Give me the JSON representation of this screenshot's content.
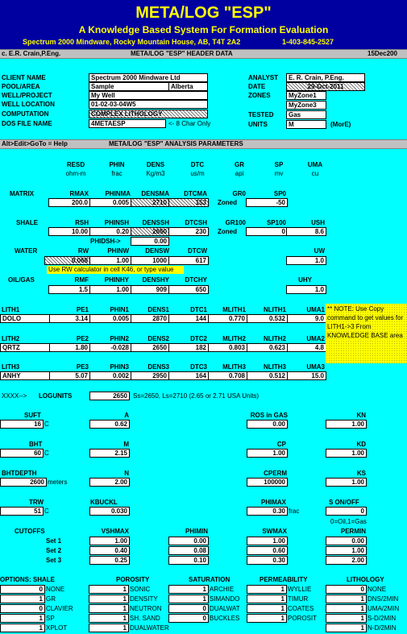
{
  "title": {
    "main": "META/LOG \"ESP\"",
    "sub": "A Knowledge Based System For Formation Evaluation",
    "company": "Spectrum 2000 Mindware, Rocky Mountain House, AB, T4T 2A2",
    "phone": "1-403-845-2527"
  },
  "header_bar": {
    "author": "c. E.R. Crain,P.Eng.",
    "title": "META/LOG \"ESP\" HEADER DATA",
    "date": "15Dec200"
  },
  "header": {
    "client_label": "CLIENT NAME",
    "client": "Spectrum 2000 Mindware Ltd",
    "pool_label": "POOL/AREA",
    "pool": "Sample",
    "area": "Alberta",
    "well_label": "WELL/PROJECT",
    "well": "My Well",
    "loc_label": "WELL LOCATION",
    "loc": "01-02-03-04W5",
    "comp_label": "COMPUTATION",
    "comp": "COMPLEX LITHOLOGY",
    "dos_label": "DOS FILE NAME",
    "dos": "4METAESP",
    "dos_note": "<- 8 Char Only",
    "analyst_label": "ANALYST",
    "analyst": "E. R. Crain, P.Eng.",
    "date_label": "DATE",
    "date": "29-Oct-2011",
    "zones_label": "ZONES",
    "zone1": "MyZone1",
    "zone2": "MyZone3",
    "tested_label": "TESTED",
    "tested": "Gas",
    "units_label": "UNITS",
    "units": "M",
    "units_note": "(MorE)"
  },
  "analysis_bar": {
    "nav": "Alt>Edit>GoTo = Help",
    "title": "META/LOG \"ESP\" ANALYSIS PARAMETERS"
  },
  "col_heads": [
    {
      "name": "RESD",
      "unit": "ohm-m"
    },
    {
      "name": "PHIN",
      "unit": "frac"
    },
    {
      "name": "DENS",
      "unit": "Kg/m3"
    },
    {
      "name": "DTC",
      "unit": "us/m"
    },
    {
      "name": "GR",
      "unit": "api"
    },
    {
      "name": "SP",
      "unit": "mv"
    },
    {
      "name": "UMA",
      "unit": "cu"
    }
  ],
  "matrix": {
    "label": "MATRIX",
    "h": [
      "RMAX",
      "PHINMA",
      "DENSMA",
      "DTCMA",
      "GR0",
      "SP0"
    ],
    "v": [
      "200.0",
      "0.005",
      "2710",
      "153",
      "",
      "-50"
    ],
    "zoned": "Zoned"
  },
  "shale": {
    "label": "SHALE",
    "h": [
      "RSH",
      "PHINSH",
      "DENSSH",
      "DTCSH",
      "GR100",
      "SP100",
      "USH"
    ],
    "v": [
      "10.00",
      "0.20",
      "2650",
      "230",
      "",
      "0",
      "8.6"
    ],
    "zoned": "Zoned",
    "phidsh_label": "PHIDSH->",
    "phidsh": "0.00"
  },
  "water": {
    "label": "WATER",
    "h": [
      "RW",
      "PHINW",
      "DENSW",
      "DTCW",
      "UW"
    ],
    "v": [
      "0.068",
      "1.00",
      "1000",
      "617",
      "1.0"
    ],
    "note": "Use RW calculator in cell K46, or type value"
  },
  "oilgas": {
    "label": "OIL/GAS",
    "h": [
      "RMF",
      "PHINHY",
      "DENSHY",
      "DTCHY",
      "UHY"
    ],
    "v": [
      "1.5",
      "1.00",
      "909",
      "650",
      "1.0"
    ]
  },
  "lith1": {
    "h": [
      "LITH1",
      "PE1",
      "PHIN1",
      "DENS1",
      "DTC1",
      "MLITH1",
      "NLITH1",
      "UMA1"
    ],
    "v": [
      "DOLO",
      "3.14",
      "0.005",
      "2870",
      "144",
      "0.770",
      "0.532",
      "9.0"
    ]
  },
  "lith2": {
    "h": [
      "LITH2",
      "PE2",
      "PHIN2",
      "DENS2",
      "DTC2",
      "MLITH2",
      "NLITH2",
      "UMA2"
    ],
    "v": [
      "QRTZ",
      "1.80",
      "-0.028",
      "2650",
      "182",
      "0.803",
      "0.623",
      "4.8"
    ]
  },
  "lith3": {
    "h": [
      "LITH3",
      "PE3",
      "PHIN3",
      "DENS3",
      "DTC3",
      "MLITH3",
      "NLITH3",
      "UMA3"
    ],
    "v": [
      "ANHY",
      "5.07",
      "0.002",
      "2950",
      "164",
      "0.708",
      "0.512",
      "15.0"
    ]
  },
  "lith_note": "** NOTE: Use Copy command to get values for LITH1->3 From KNOWLEDGE BASE area",
  "logunits": {
    "arrow": "XXXX-->",
    "label": "LOGUNITS",
    "value": "2650",
    "note": "Ss=2650, Ls=2710 (2.65 or 2.71 USA Units)"
  },
  "params": {
    "suft": {
      "label": "SUFT",
      "value": "16",
      "unit": "C"
    },
    "a": {
      "label": "A",
      "value": "0.62"
    },
    "rosgas": {
      "label": "ROS in GAS",
      "value": "0.00"
    },
    "kn": {
      "label": "KN",
      "value": "1.00"
    },
    "bht": {
      "label": "BHT",
      "value": "60",
      "unit": "C"
    },
    "m": {
      "label": "M",
      "value": "2.15"
    },
    "cp": {
      "label": "CP",
      "value": "1.00"
    },
    "kd": {
      "label": "KD",
      "value": "1.00"
    },
    "bhtdepth": {
      "label": "BHTDEPTH",
      "value": "2600",
      "unit": "meters"
    },
    "n": {
      "label": "N",
      "value": "2.00"
    },
    "cperm": {
      "label": "CPERM",
      "value": "100000"
    },
    "ks": {
      "label": "KS",
      "value": "1.00"
    },
    "trw": {
      "label": "TRW",
      "value": "51",
      "unit": "C"
    },
    "kbuckl": {
      "label": "KBUCKL",
      "value": "0.030"
    },
    "phimax": {
      "label": "PHIMAX",
      "value": "0.30",
      "unit": "frac"
    },
    "sonoff": {
      "label": "S ON/OFF",
      "value": "0",
      "note": "0=Oil,1=Gas"
    }
  },
  "cutoffs": {
    "label": "CUTOFFS",
    "heads": [
      "VSHMAX",
      "PHIMIN",
      "SWMAX",
      "PERMIN"
    ],
    "rows": [
      {
        "label": "Set 1",
        "v": [
          "1.00",
          "0.00",
          "1.00",
          "0.00"
        ]
      },
      {
        "label": "Set 2",
        "v": [
          "0.40",
          "0.08",
          "0.60",
          "1.00"
        ]
      },
      {
        "label": "Set 3",
        "v": [
          "0.25",
          "0.10",
          "0.30",
          "2.00"
        ]
      }
    ]
  },
  "options": {
    "label": "OPTIONS: SHALE",
    "heads": [
      "POROSITY",
      "SATURATION",
      "PERMEABILITY",
      "LITHOLOGY"
    ],
    "rows": [
      {
        "s": "0",
        "sl": "NONE",
        "p": "1",
        "pl": "SONIC",
        "sa": "1",
        "sal": "ARCHIE",
        "pe": "1",
        "pel": "WYLLIE",
        "l": "0",
        "ll": "NONE"
      },
      {
        "s": "1",
        "sl": "GR",
        "p": "1",
        "pl": "DENSITY",
        "sa": "1",
        "sal": "SIMANDO",
        "pe": "1",
        "pel": "TIMUR",
        "l": "1",
        "ll": "DNS/2MIN"
      },
      {
        "s": "0",
        "sl": "CLAVIER",
        "p": "1",
        "pl": "NEUTRON",
        "sa": "0",
        "sal": "DUALWAT",
        "pe": "1",
        "pel": "COATES",
        "l": "1",
        "ll": "UMA/2MIN"
      },
      {
        "s": "1",
        "sl": "SP",
        "p": "1",
        "pl": "SH. SAND",
        "sa": "0",
        "sal": "BUCKLES",
        "pe": "1",
        "pel": "POROSIT",
        "l": "1",
        "ll": "S-D/2MIN"
      },
      {
        "s": "1",
        "sl": "XPLOT",
        "p": "1",
        "pl": "DUALWATER",
        "sa": "",
        "sal": "",
        "pe": "",
        "pel": "",
        "l": "1",
        "ll": "N-D/2MIN"
      }
    ]
  },
  "colors": {
    "background": "#00ffff",
    "title_band": "#0000a0",
    "title_text": "#ffff00",
    "note_bg": "#ffff00",
    "grid_gray": "#c0c0c0"
  }
}
